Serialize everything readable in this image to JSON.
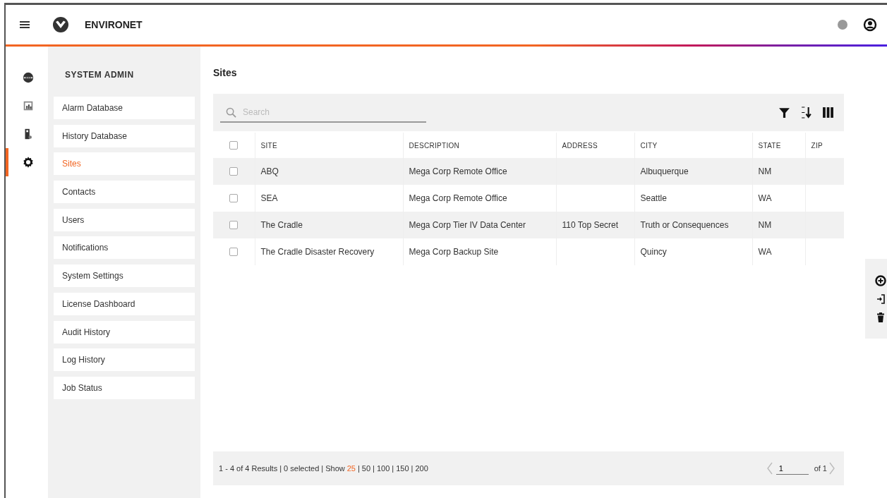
{
  "app": {
    "name": "ENVIRONET"
  },
  "rail": [
    {
      "selected": false
    },
    {
      "selected": false
    },
    {
      "selected": false
    },
    {
      "selected": true
    }
  ],
  "sidebar": {
    "title": "SYSTEM ADMIN",
    "items": [
      {
        "label": "Alarm Database",
        "selected": false
      },
      {
        "label": "History Database",
        "selected": false
      },
      {
        "label": "Sites",
        "selected": true
      },
      {
        "label": "Contacts",
        "selected": false
      },
      {
        "label": "Users",
        "selected": false
      },
      {
        "label": "Notifications",
        "selected": false
      },
      {
        "label": "System Settings",
        "selected": false
      },
      {
        "label": "License Dashboard",
        "selected": false
      },
      {
        "label": "Audit History",
        "selected": false
      },
      {
        "label": "Log History",
        "selected": false
      },
      {
        "label": "Job Status",
        "selected": false
      }
    ]
  },
  "page_title": "Sites",
  "search": {
    "placeholder": "Search"
  },
  "table": {
    "header_checked": false,
    "columns": [
      "SITE",
      "DESCRIPTION",
      "ADDRESS",
      "CITY",
      "STATE",
      "ZIP"
    ],
    "rows": [
      {
        "checked": false,
        "cells": [
          "ABQ",
          "Mega Corp Remote Office",
          "",
          "Albuquerque",
          "NM",
          ""
        ]
      },
      {
        "checked": false,
        "cells": [
          "SEA",
          "Mega Corp Remote Office",
          "",
          "Seattle",
          "WA",
          ""
        ]
      },
      {
        "checked": false,
        "cells": [
          "The Cradle",
          "Mega Corp Tier IV Data Center",
          "110 Top Secret",
          "Truth or Consequences",
          "NM",
          ""
        ]
      },
      {
        "checked": false,
        "cells": [
          "The Cradle Disaster Recovery",
          "Mega Corp Backup Site",
          "",
          "Quincy",
          "WA",
          ""
        ]
      }
    ]
  },
  "footer": {
    "summary": "1 - 4 of 4 Results | 0 selected | Show",
    "separator": "|",
    "page_sizes": [
      {
        "label": "25",
        "selected": true
      },
      {
        "label": "50",
        "selected": false
      },
      {
        "label": "100",
        "selected": false
      },
      {
        "label": "150",
        "selected": false
      },
      {
        "label": "200",
        "selected": false
      }
    ],
    "page": "1",
    "page_total": "of 1"
  }
}
